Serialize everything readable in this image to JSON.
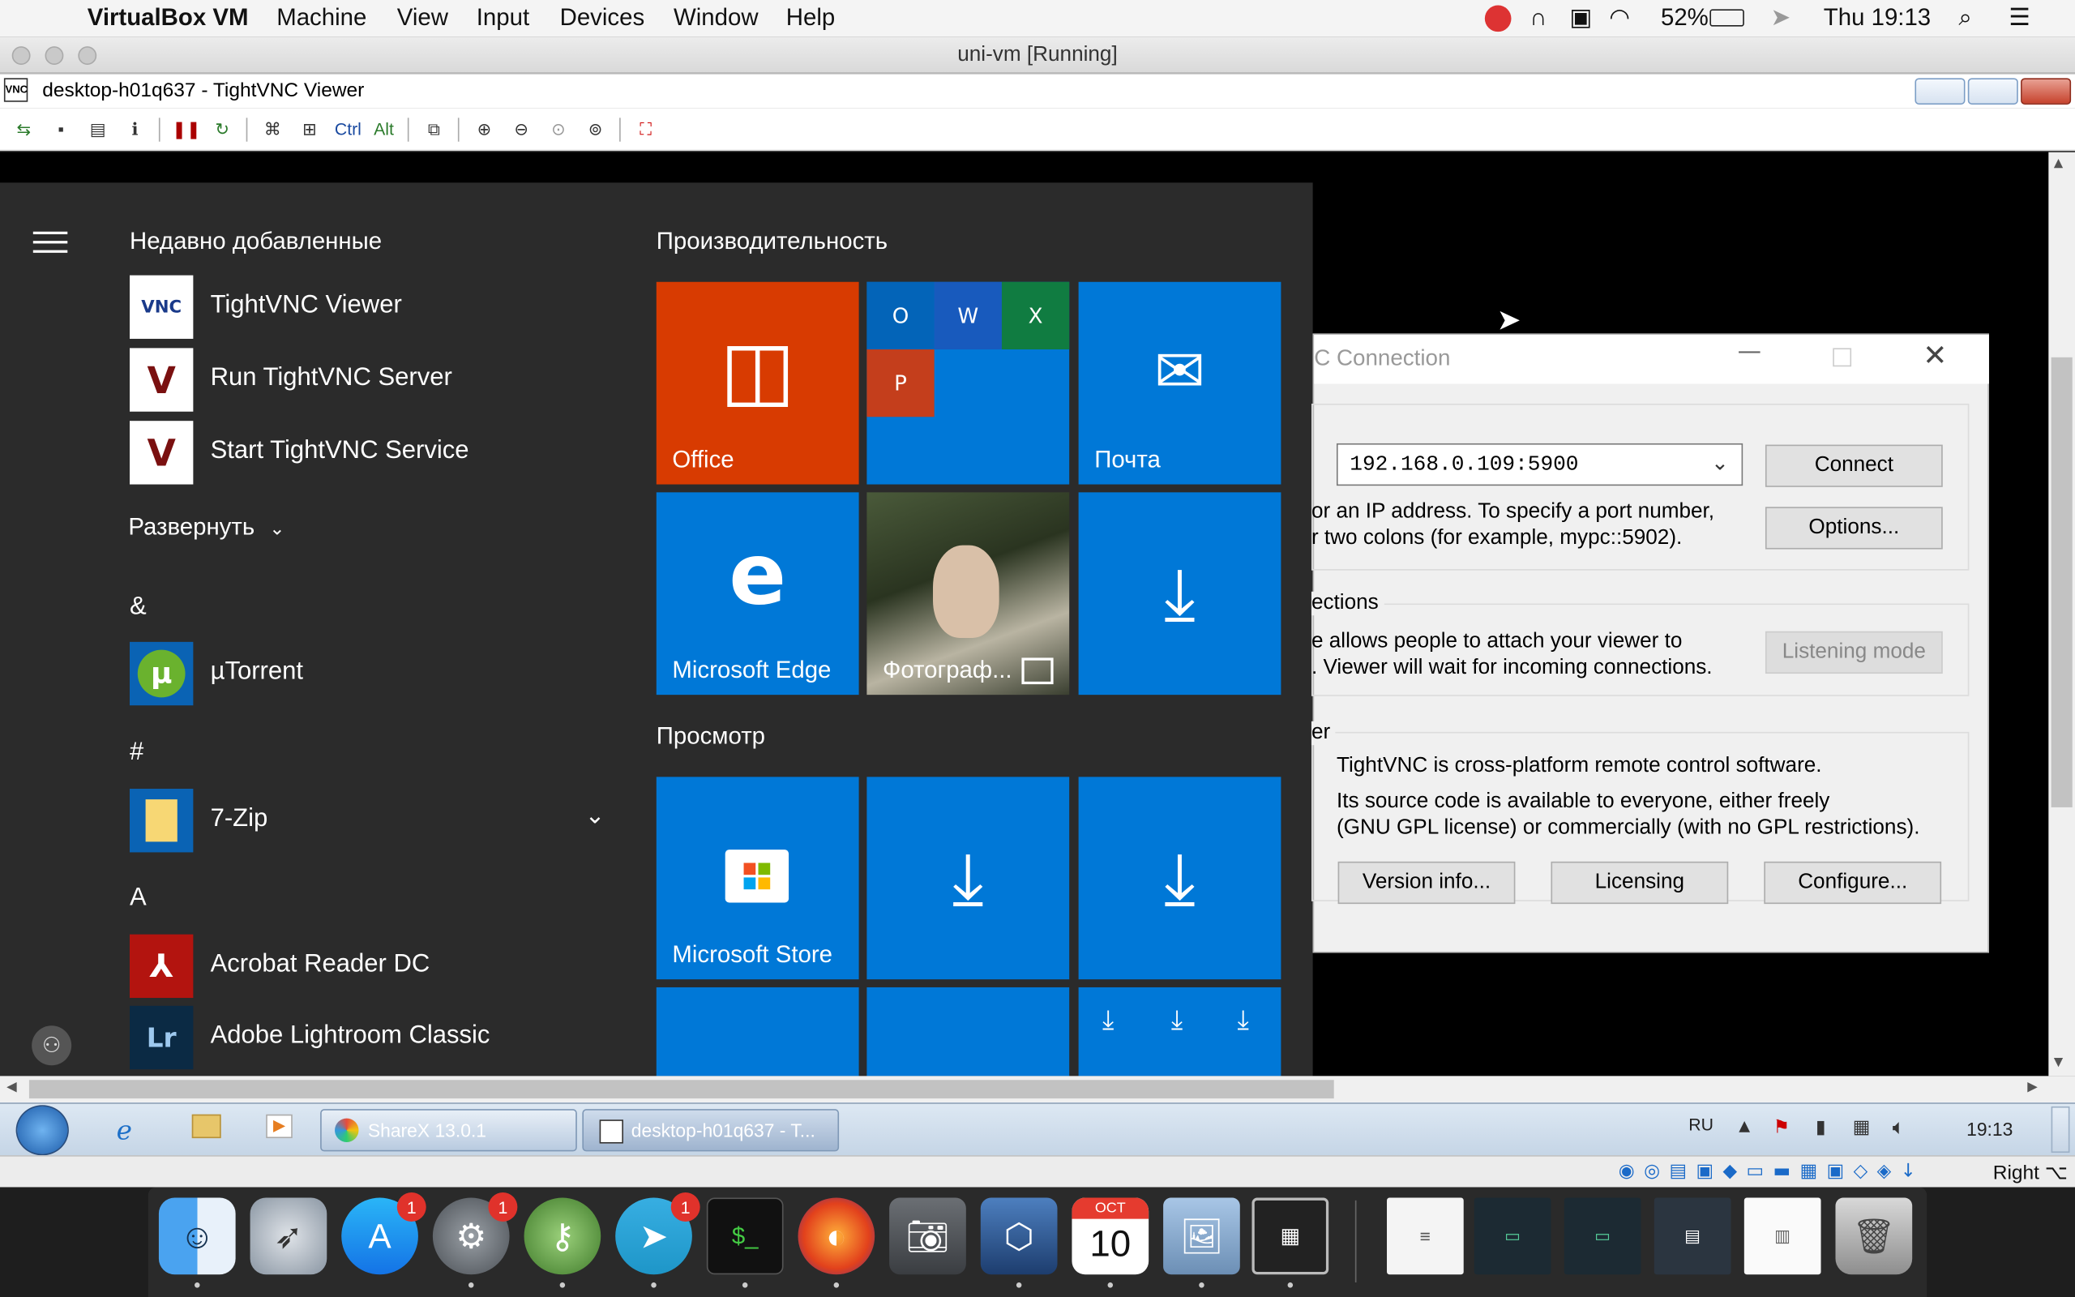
{
  "menubar": {
    "app": "VirtualBox VM",
    "items": [
      "Machine",
      "View",
      "Input",
      "Devices",
      "Window",
      "Help"
    ],
    "battery": "52%",
    "clock": "Thu 19:13"
  },
  "vm_window": {
    "title": "uni-vm [Running]"
  },
  "vnc_window": {
    "title": "desktop-h01q637 - TightVNC Viewer",
    "toolbar": {
      "ctrl": "Ctrl",
      "alt": "Alt"
    }
  },
  "start_menu": {
    "recent_header": "Недавно добавленные",
    "recent": [
      {
        "label": "TightVNC Viewer",
        "icon": "tightvnc-viewer-icon"
      },
      {
        "label": "Run TightVNC Server",
        "icon": "tightvnc-server-icon"
      },
      {
        "label": "Start TightVNC Service",
        "icon": "tightvnc-service-icon"
      }
    ],
    "expand": "Развернуть",
    "letters": [
      "&",
      "#",
      "A"
    ],
    "apps": [
      {
        "label": "µTorrent"
      },
      {
        "label": "7-Zip"
      },
      {
        "label": "Acrobat Reader DC"
      },
      {
        "label": "Adobe Lightroom Classic"
      }
    ],
    "group1": "Производительность",
    "group2": "Просмотр",
    "tiles": {
      "office": "Office",
      "mail": "Почта",
      "edge": "Microsoft Edge",
      "photos": "Фотограф...",
      "store": "Microsoft Store"
    }
  },
  "dialog": {
    "title": "C Connection",
    "host": "192.168.0.109:5900",
    "connect": "Connect",
    "options": "Options...",
    "hint1": "or an IP address. To specify a port number,",
    "hint2": "r two colons (for example, mypc::5902).",
    "listen_header": "ections",
    "listen1": "e allows people to attach your viewer to",
    "listen2": ". Viewer will wait for incoming connections.",
    "listening": "Listening mode",
    "about_header": "er",
    "about1": "TightVNC is cross-platform remote control software.",
    "about2": "Its source code is available to everyone, either freely",
    "about3": "(GNU GPL license) or commercially (with no GPL restrictions).",
    "version": "Version info...",
    "licensing": "Licensing",
    "configure": "Configure..."
  },
  "taskbar": {
    "tasks": [
      "ShareX 13.0.1",
      "desktop-h01q637 - T..."
    ],
    "lang": "RU",
    "time": "19:13"
  },
  "vm_status": {
    "host_key": "Right ⌥"
  },
  "dock": {
    "badges": {
      "appstore": "1",
      "prefs": "1",
      "telegram": "1"
    },
    "calendar_month": "OCT",
    "calendar_day": "10"
  }
}
